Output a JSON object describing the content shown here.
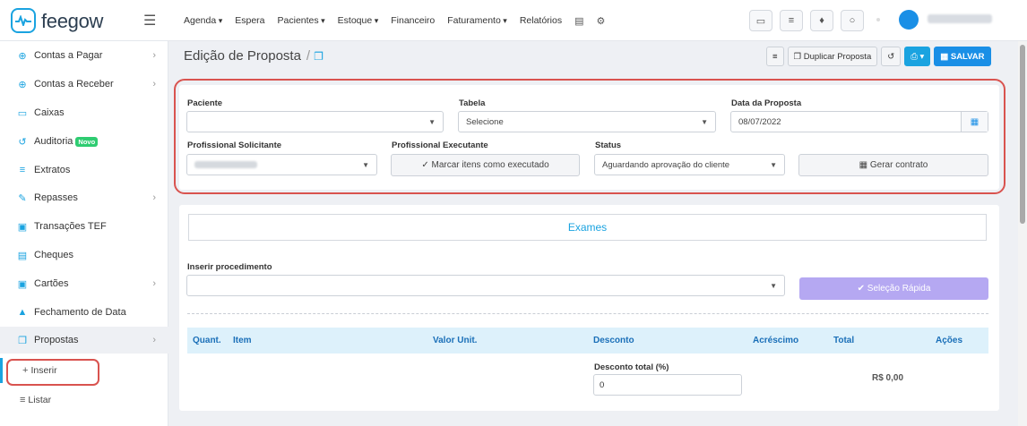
{
  "brand": {
    "name": "feegow"
  },
  "nav": {
    "items": [
      {
        "label": "Agenda",
        "caret": true
      },
      {
        "label": "Espera",
        "caret": false
      },
      {
        "label": "Pacientes",
        "caret": true
      },
      {
        "label": "Estoque",
        "caret": true
      },
      {
        "label": "Financeiro",
        "caret": false
      },
      {
        "label": "Faturamento",
        "caret": true
      },
      {
        "label": "Relatórios",
        "caret": false
      }
    ]
  },
  "sidebar": {
    "items": [
      {
        "label": "Contas a Pagar",
        "icon": "plus-circle-icon",
        "chevron": true
      },
      {
        "label": "Contas a Receber",
        "icon": "plus-circle-icon",
        "chevron": true
      },
      {
        "label": "Caixas",
        "icon": "inbox-icon",
        "chevron": false
      },
      {
        "label": "Auditoria",
        "icon": "history-icon",
        "chevron": false,
        "badge": "Novo"
      },
      {
        "label": "Extratos",
        "icon": "list-icon",
        "chevron": false
      },
      {
        "label": "Repasses",
        "icon": "handshake-icon",
        "chevron": true
      },
      {
        "label": "Transações TEF",
        "icon": "card-icon",
        "chevron": false
      },
      {
        "label": "Cheques",
        "icon": "check-doc-icon",
        "chevron": false
      },
      {
        "label": "Cartões",
        "icon": "card-icon",
        "chevron": true
      },
      {
        "label": "Fechamento de Data",
        "icon": "lock-icon",
        "chevron": false
      },
      {
        "label": "Propostas",
        "icon": "copy-icon",
        "chevron": true
      }
    ],
    "sub": [
      {
        "label": "Inserir"
      },
      {
        "label": "Listar"
      }
    ]
  },
  "page": {
    "title": "Edição de Proposta",
    "buttons": {
      "duplicate": "Duplicar Proposta",
      "save": "SALVAR"
    }
  },
  "form": {
    "paciente_label": "Paciente",
    "tabela_label": "Tabela",
    "tabela_value": "Selecione",
    "data_label": "Data da Proposta",
    "data_value": "08/07/2022",
    "prof_sol_label": "Profissional Solicitante",
    "prof_exec_label": "Profissional Executante",
    "prof_exec_button": "Marcar itens como executado",
    "status_label": "Status",
    "status_value": "Aguardando aprovação do cliente",
    "contract_button": "Gerar contrato"
  },
  "exames": {
    "tab_label": "Exames",
    "inserir_label": "Inserir procedimento",
    "quick_select": "Seleção Rápida",
    "columns": [
      "Quant.",
      "Item",
      "Valor Unit.",
      "Desconto",
      "Acréscimo",
      "Total",
      "Ações"
    ],
    "discount_label": "Desconto total (%)",
    "discount_value": "0",
    "total_value": "R$ 0,00"
  },
  "colors": {
    "accent": "#1aa3e0",
    "highlight": "#d9534f",
    "quick_select": "#b5a8f2"
  }
}
